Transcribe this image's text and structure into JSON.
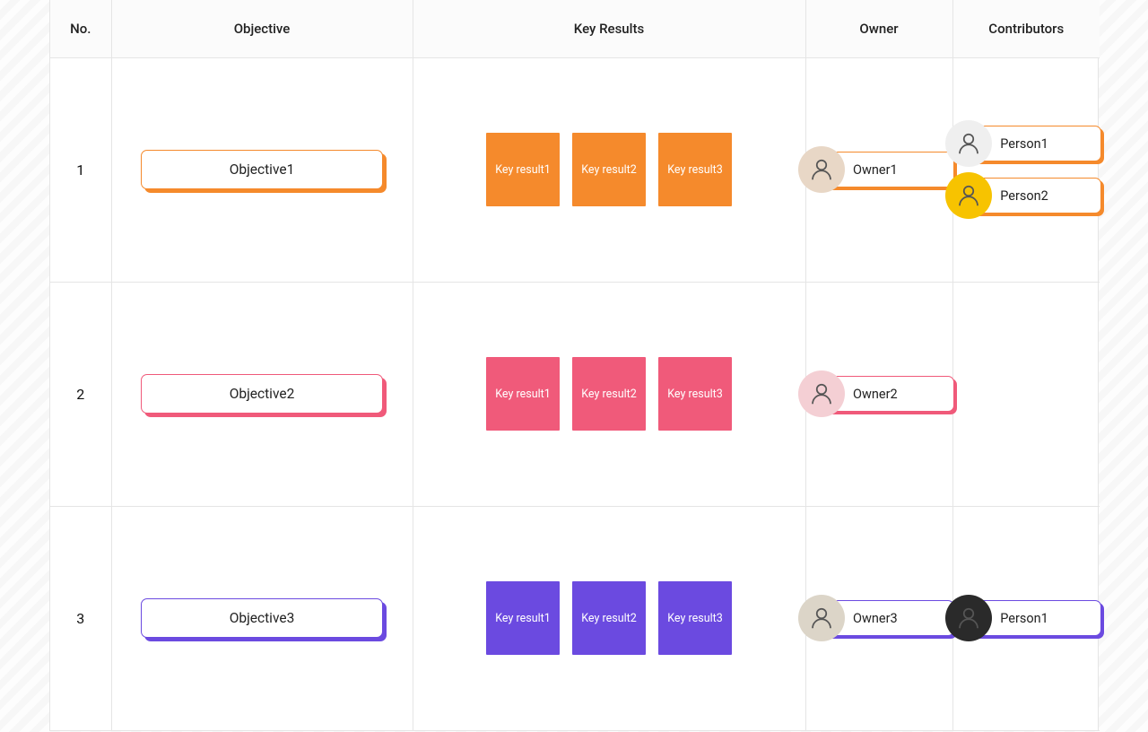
{
  "headers": {
    "no": "No.",
    "objective": "Objective",
    "keyResults": "Key Results",
    "owner": "Owner",
    "contributors": "Contributors"
  },
  "rows": [
    {
      "no": "1",
      "color": "#f58a2c",
      "objective": "Objective1",
      "keyResults": [
        "Key result1",
        "Key result2",
        "Key result3"
      ],
      "owner": {
        "name": "Owner1",
        "avatarBg": "#e8d7c6"
      },
      "contributors": [
        {
          "name": "Person1",
          "avatarBg": "#efefef"
        },
        {
          "name": "Person2",
          "avatarBg": "#f7c300"
        }
      ]
    },
    {
      "no": "2",
      "color": "#f05a7a",
      "objective": "Objective2",
      "keyResults": [
        "Key result1",
        "Key result2",
        "Key result3"
      ],
      "owner": {
        "name": "Owner2",
        "avatarBg": "#f4cfd4"
      },
      "contributors": []
    },
    {
      "no": "3",
      "color": "#6b4ae0",
      "objective": "Objective3",
      "keyResults": [
        "Key result1",
        "Key result2",
        "Key result3"
      ],
      "owner": {
        "name": "Owner3",
        "avatarBg": "#dcd5c8"
      },
      "contributors": [
        {
          "name": "Person1",
          "avatarBg": "#2a2a2a"
        }
      ]
    }
  ]
}
